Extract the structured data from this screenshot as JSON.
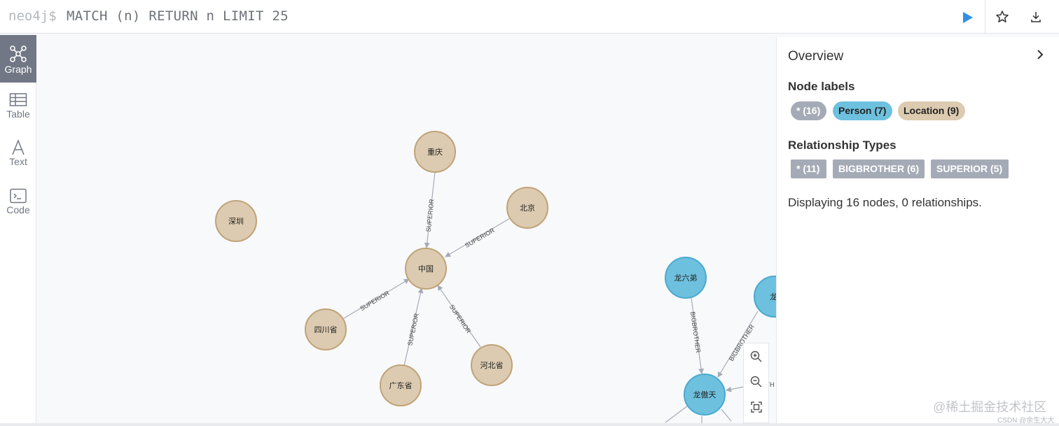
{
  "editor": {
    "prompt": "neo4j$",
    "query": "MATCH (n) RETURN n LIMIT 25",
    "run_icon": "play-icon",
    "favorite_icon": "star-icon",
    "download_icon": "download-icon"
  },
  "sidebar": {
    "items": [
      {
        "label": "Graph",
        "icon": "graph-icon",
        "active": true
      },
      {
        "label": "Table",
        "icon": "table-icon",
        "active": false
      },
      {
        "label": "Text",
        "icon": "text-icon",
        "active": false
      },
      {
        "label": "Code",
        "icon": "code-icon",
        "active": false
      }
    ]
  },
  "graph": {
    "location_nodes": [
      "重庆",
      "北京",
      "深圳",
      "中国",
      "四川省",
      "广东省",
      "河北省"
    ],
    "person_nodes": [
      "龙六弟",
      "龙五",
      "龙傲天"
    ],
    "relationships": [
      {
        "from": "重庆",
        "to": "中国",
        "type": "SUPERIOR"
      },
      {
        "from": "北京",
        "to": "中国",
        "type": "SUPERIOR"
      },
      {
        "from": "四川省",
        "to": "中国",
        "type": "SUPERIOR"
      },
      {
        "from": "广东省",
        "to": "中国",
        "type": "SUPERIOR"
      },
      {
        "from": "河北省",
        "to": "中国",
        "type": "SUPERIOR"
      },
      {
        "from": "龙六弟",
        "to": "龙傲天",
        "type": "BIGBROTHER"
      },
      {
        "from": "龙五",
        "to": "龙傲天",
        "type": "BIGBROTHER"
      }
    ],
    "partial_rel_label": "OTH",
    "colors": {
      "location_fill": "#dccbb0",
      "location_stroke": "#c0a378",
      "person_fill": "#6ec1de",
      "person_stroke": "#4aa9cf",
      "edge": "#a5abb6"
    }
  },
  "zoom": {
    "zoom_in_icon": "zoom-in-icon",
    "zoom_out_icon": "zoom-out-icon",
    "fit_icon": "fit-screen-icon"
  },
  "overview": {
    "title": "Overview",
    "collapse_icon": "chevron-right-icon",
    "node_labels_title": "Node labels",
    "node_labels": [
      {
        "text": "* (16)",
        "color": "#a5abb6"
      },
      {
        "text": "Person (7)",
        "color": "#6ec1de"
      },
      {
        "text": "Location (9)",
        "color": "#dccbb0"
      }
    ],
    "rel_types_title": "Relationship Types",
    "rel_types": [
      {
        "text": "* (11)"
      },
      {
        "text": "BIGBROTHER (6)"
      },
      {
        "text": "SUPERIOR (5)"
      }
    ],
    "display_text": "Displaying 16 nodes, 0 relationships."
  },
  "watermark": {
    "main": "@稀土掘金技术社区",
    "sub": "CSDN @余生大大"
  }
}
